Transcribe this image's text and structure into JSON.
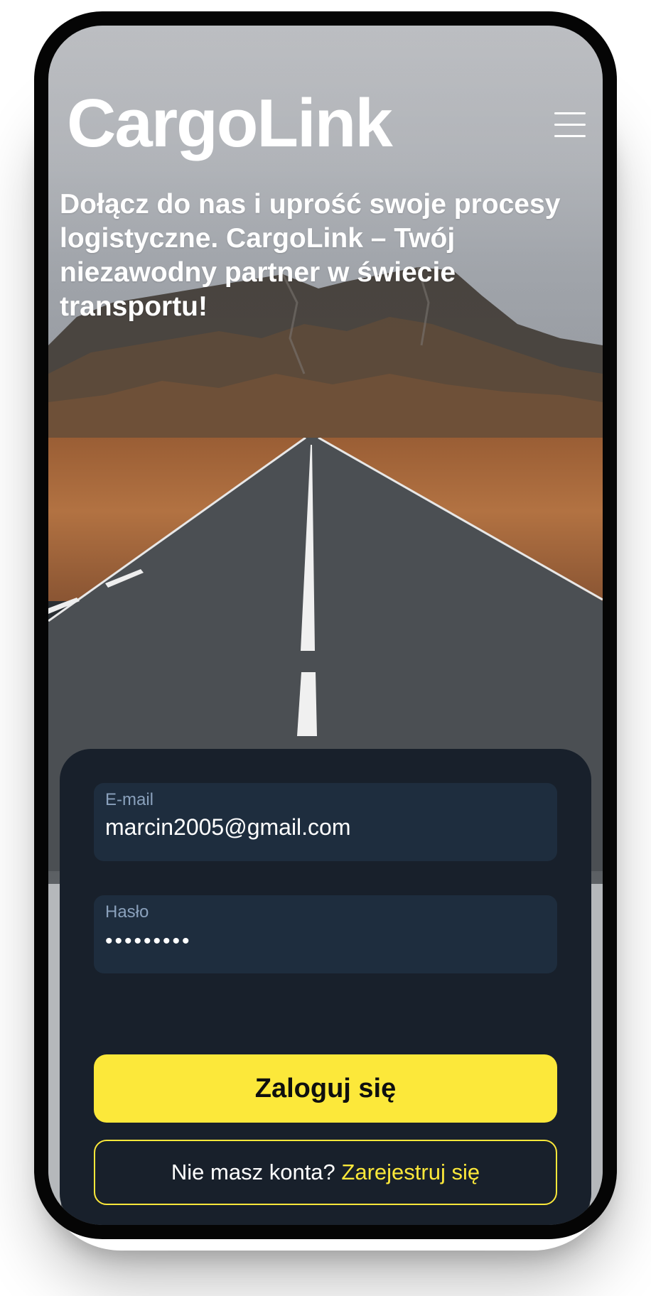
{
  "app": {
    "brand": "CargoLink",
    "menu_icon": "hamburger-menu-icon"
  },
  "hero": {
    "headline": "Dołącz do nas i uprość swoje procesy logistyczne. CargoLink – Twój niezawodny partner w świecie transportu!"
  },
  "login": {
    "email": {
      "label": "E-mail",
      "value": "marcin2005@gmail.com"
    },
    "password": {
      "label": "Hasło",
      "value": "•••••••••"
    },
    "submit_label": "Zaloguj się",
    "register_prompt": "Nie masz konta?",
    "register_link": "Zarejestruj się"
  },
  "colors": {
    "accent": "#fce83a",
    "card_bg": "#18202b",
    "field_bg": "#1e2d3e",
    "field_label": "#8aa1bc"
  }
}
